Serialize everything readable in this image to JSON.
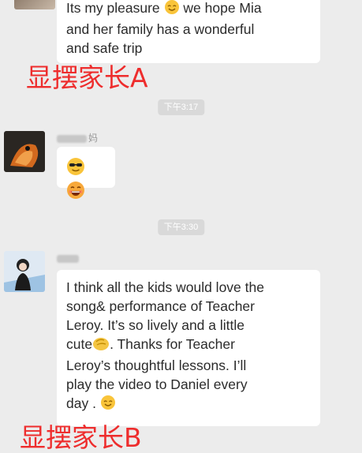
{
  "messages": [
    {
      "lines": [
        "Its my pleasure",
        "we hope Mia",
        "and her family has a wonderful",
        "and safe trip"
      ]
    },
    {
      "nickname_suffix": "妈"
    },
    {
      "lines": [
        "I think all the kids would love the",
        "song& performance of Teacher",
        "Leroy. It’s so lively and a little",
        "cute",
        ". Thanks for Teacher",
        "Leroy’s thoughtful lessons. I’ll",
        "play the video to Daniel every",
        "day ."
      ]
    }
  ],
  "timestamps": [
    "下午3:17",
    "下午3:30"
  ],
  "captions": [
    "显摆家长A",
    "显摆家长B"
  ],
  "icons": {
    "smile": "smiling-face-icon",
    "sunglasses": "sunglasses-face-icon",
    "grin": "grinning-face-icon",
    "clap": "clapping-hands-icon"
  },
  "colors": {
    "background": "#ececec",
    "bubble": "#ffffff",
    "caption": "#ee2d2d",
    "timestamp_bg": "#d9d9d9"
  }
}
